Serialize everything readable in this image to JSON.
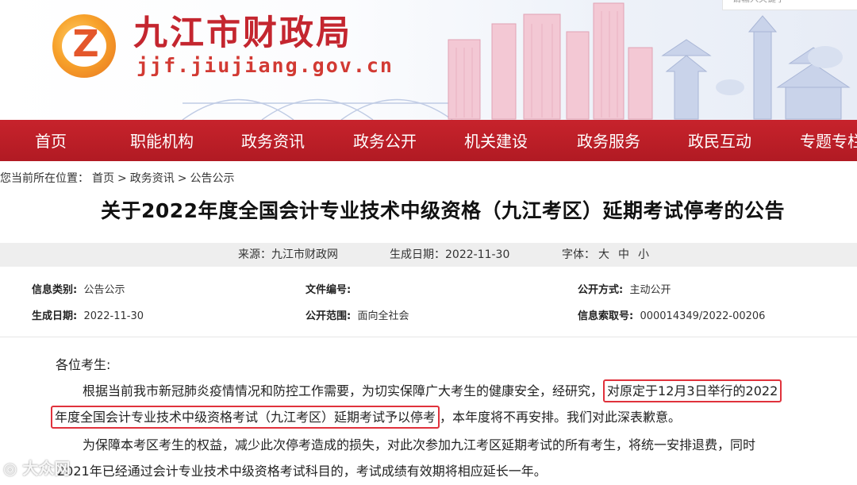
{
  "header": {
    "site_title": "九江市财政局",
    "site_domain": "jjf.jiujiang.gov.cn",
    "topright_text": "请输入关键字"
  },
  "nav": {
    "items": [
      {
        "label": "首页"
      },
      {
        "label": "职能机构"
      },
      {
        "label": "政务资讯"
      },
      {
        "label": "政务公开"
      },
      {
        "label": "机关建设"
      },
      {
        "label": "政务服务"
      },
      {
        "label": "政民互动"
      },
      {
        "label": "专题专栏"
      }
    ]
  },
  "breadcrumb": {
    "prefix": "您当前所在位置：",
    "home": "首页",
    "sep": ">",
    "section": "政务资讯",
    "page": "公告公示"
  },
  "article": {
    "title": "关于2022年度全国会计专业技术中级资格（九江考区）延期考试停考的公告",
    "meta": {
      "source": "来源：九江市财政网",
      "date": "生成日期：2022-11-30",
      "font_label": "字体：",
      "font_large": "大",
      "font_medium": "中",
      "font_small": "小"
    },
    "info": {
      "category_label": "信息类别:",
      "category_value": "公告公示",
      "docno_label": "文件编号:",
      "docno_value": "",
      "method_label": "公开方式:",
      "method_value": "主动公开",
      "gen_date_label": "生成日期:",
      "gen_date_value": "2022-11-30",
      "scope_label": "公开范围:",
      "scope_value": "面向全社会",
      "index_label": "信息索取号:",
      "index_value": "000014349/2022-00206"
    },
    "body": {
      "greeting": "各位考生:",
      "p1_a": "根据当前我市新冠肺炎疫情情况和防控工作需要，为切实保障广大考生的健康安全，经研究，",
      "p1_hl1": "对原定于12月3日举行的2022",
      "p1_hl2": "年度全国会计专业技术中级资格考试（九江考区）延期考试予以停考",
      "p1_b": "，本年度将不再安排。我们对此深表歉意。",
      "p2_a": "为保障本考区考生的权益，减少此次停考造成的损失，对此次参加九江考区延期考试的所有考生，将统一安排退费，同时",
      "p2_b": "2021年已经通过会计专业技术中级资格考试科目的，考试成绩有效期将相应延长一年。"
    }
  },
  "watermark": "大众网"
}
